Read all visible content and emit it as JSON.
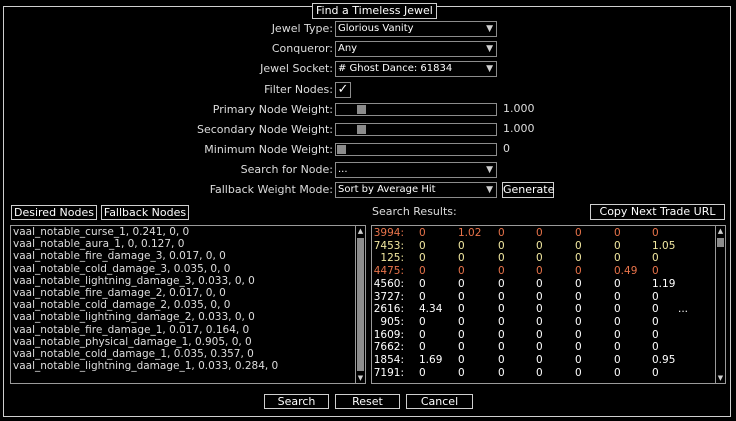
{
  "dialog": {
    "title": "Find a Timeless Jewel"
  },
  "form": {
    "jewel_type": {
      "label": "Jewel Type:",
      "value": "Glorious Vanity"
    },
    "conqueror": {
      "label": "Conqueror:",
      "value": "Any"
    },
    "jewel_socket": {
      "label": "Jewel Socket:",
      "value": "# Ghost Dance: 61834"
    },
    "filter_nodes": {
      "label": "Filter Nodes:",
      "checked": true,
      "glyph": "✓"
    },
    "primary_weight": {
      "label": "Primary Node Weight:",
      "value": "1.000",
      "level": 0.09
    },
    "secondary_weight": {
      "label": "Secondary Node Weight:",
      "value": "1.000",
      "level": 0.09
    },
    "minimum_weight": {
      "label": "Minimum Node Weight:",
      "value": "0",
      "level": 0.0
    },
    "search_node": {
      "label": "Search for Node:",
      "value": "..."
    },
    "fallback_mode": {
      "label": "Fallback Weight Mode:",
      "value": "Sort by Average Hit"
    },
    "generate_label": "Generate"
  },
  "tabs": {
    "desired": "Desired Nodes",
    "fallback": "Fallback Nodes"
  },
  "results_header": "Search Results:",
  "copy_trade_label": "Copy Next Trade URL",
  "desired_nodes": [
    "vaal_notable_curse_1, 0.241, 0, 0",
    "vaal_notable_aura_1, 0, 0.127, 0",
    "vaal_notable_fire_damage_3, 0.017, 0, 0",
    "vaal_notable_cold_damage_3, 0.035, 0, 0",
    "vaal_notable_lightning_damage_3, 0.033, 0, 0",
    "vaal_notable_fire_damage_2, 0.017, 0, 0",
    "vaal_notable_cold_damage_2, 0.035, 0, 0",
    "vaal_notable_lightning_damage_2, 0.033, 0, 0",
    "vaal_notable_fire_damage_1, 0.017, 0.164, 0",
    "vaal_notable_physical_damage_1, 0.905, 0, 0",
    "vaal_notable_cold_damage_1, 0.035, 0.357, 0",
    "vaal_notable_lightning_damage_1, 0.033, 0.284, 0"
  ],
  "results": [
    {
      "id": "3994:",
      "cols": [
        "0",
        "1.02",
        "0",
        "0",
        "0",
        "0",
        "0"
      ],
      "color": "#e8734a"
    },
    {
      "id": "7453:",
      "cols": [
        "0",
        "0",
        "0",
        "0",
        "0",
        "0",
        "1.05"
      ],
      "color": "#f2e8a0"
    },
    {
      "id": "125:",
      "cols": [
        "0",
        "0",
        "0",
        "0",
        "0",
        "0",
        "0"
      ],
      "color": "#f2e8a0"
    },
    {
      "id": "4475:",
      "cols": [
        "0",
        "0",
        "0",
        "0",
        "0",
        "0.49",
        "0"
      ],
      "color": "#e8734a"
    },
    {
      "id": "4560:",
      "cols": [
        "0",
        "0",
        "0",
        "0",
        "0",
        "0",
        "1.19"
      ],
      "color": "#ffffff"
    },
    {
      "id": "3727:",
      "cols": [
        "0",
        "0",
        "0",
        "0",
        "0",
        "0",
        "0"
      ],
      "color": "#ffffff"
    },
    {
      "id": "2616:",
      "cols": [
        "4.34",
        "0",
        "0",
        "0",
        "0",
        "0",
        "0",
        "..."
      ],
      "color": "#ffffff"
    },
    {
      "id": "905:",
      "cols": [
        "0",
        "0",
        "0",
        "0",
        "0",
        "0",
        "0"
      ],
      "color": "#ffffff"
    },
    {
      "id": "1609:",
      "cols": [
        "0",
        "0",
        "0",
        "0",
        "0",
        "0",
        "0"
      ],
      "color": "#ffffff"
    },
    {
      "id": "7662:",
      "cols": [
        "0",
        "0",
        "0",
        "0",
        "0",
        "0",
        "0"
      ],
      "color": "#ffffff"
    },
    {
      "id": "1854:",
      "cols": [
        "1.69",
        "0",
        "0",
        "0",
        "0",
        "0",
        "0.95"
      ],
      "color": "#ffffff"
    },
    {
      "id": "7191:",
      "cols": [
        "0",
        "0",
        "0",
        "0",
        "0",
        "0",
        "0"
      ],
      "color": "#ffffff"
    }
  ],
  "footer": {
    "search": "Search",
    "reset": "Reset",
    "cancel": "Cancel"
  },
  "icons": {
    "dropdown": "▼",
    "scroll_up": "▲",
    "scroll_down": "▼"
  }
}
